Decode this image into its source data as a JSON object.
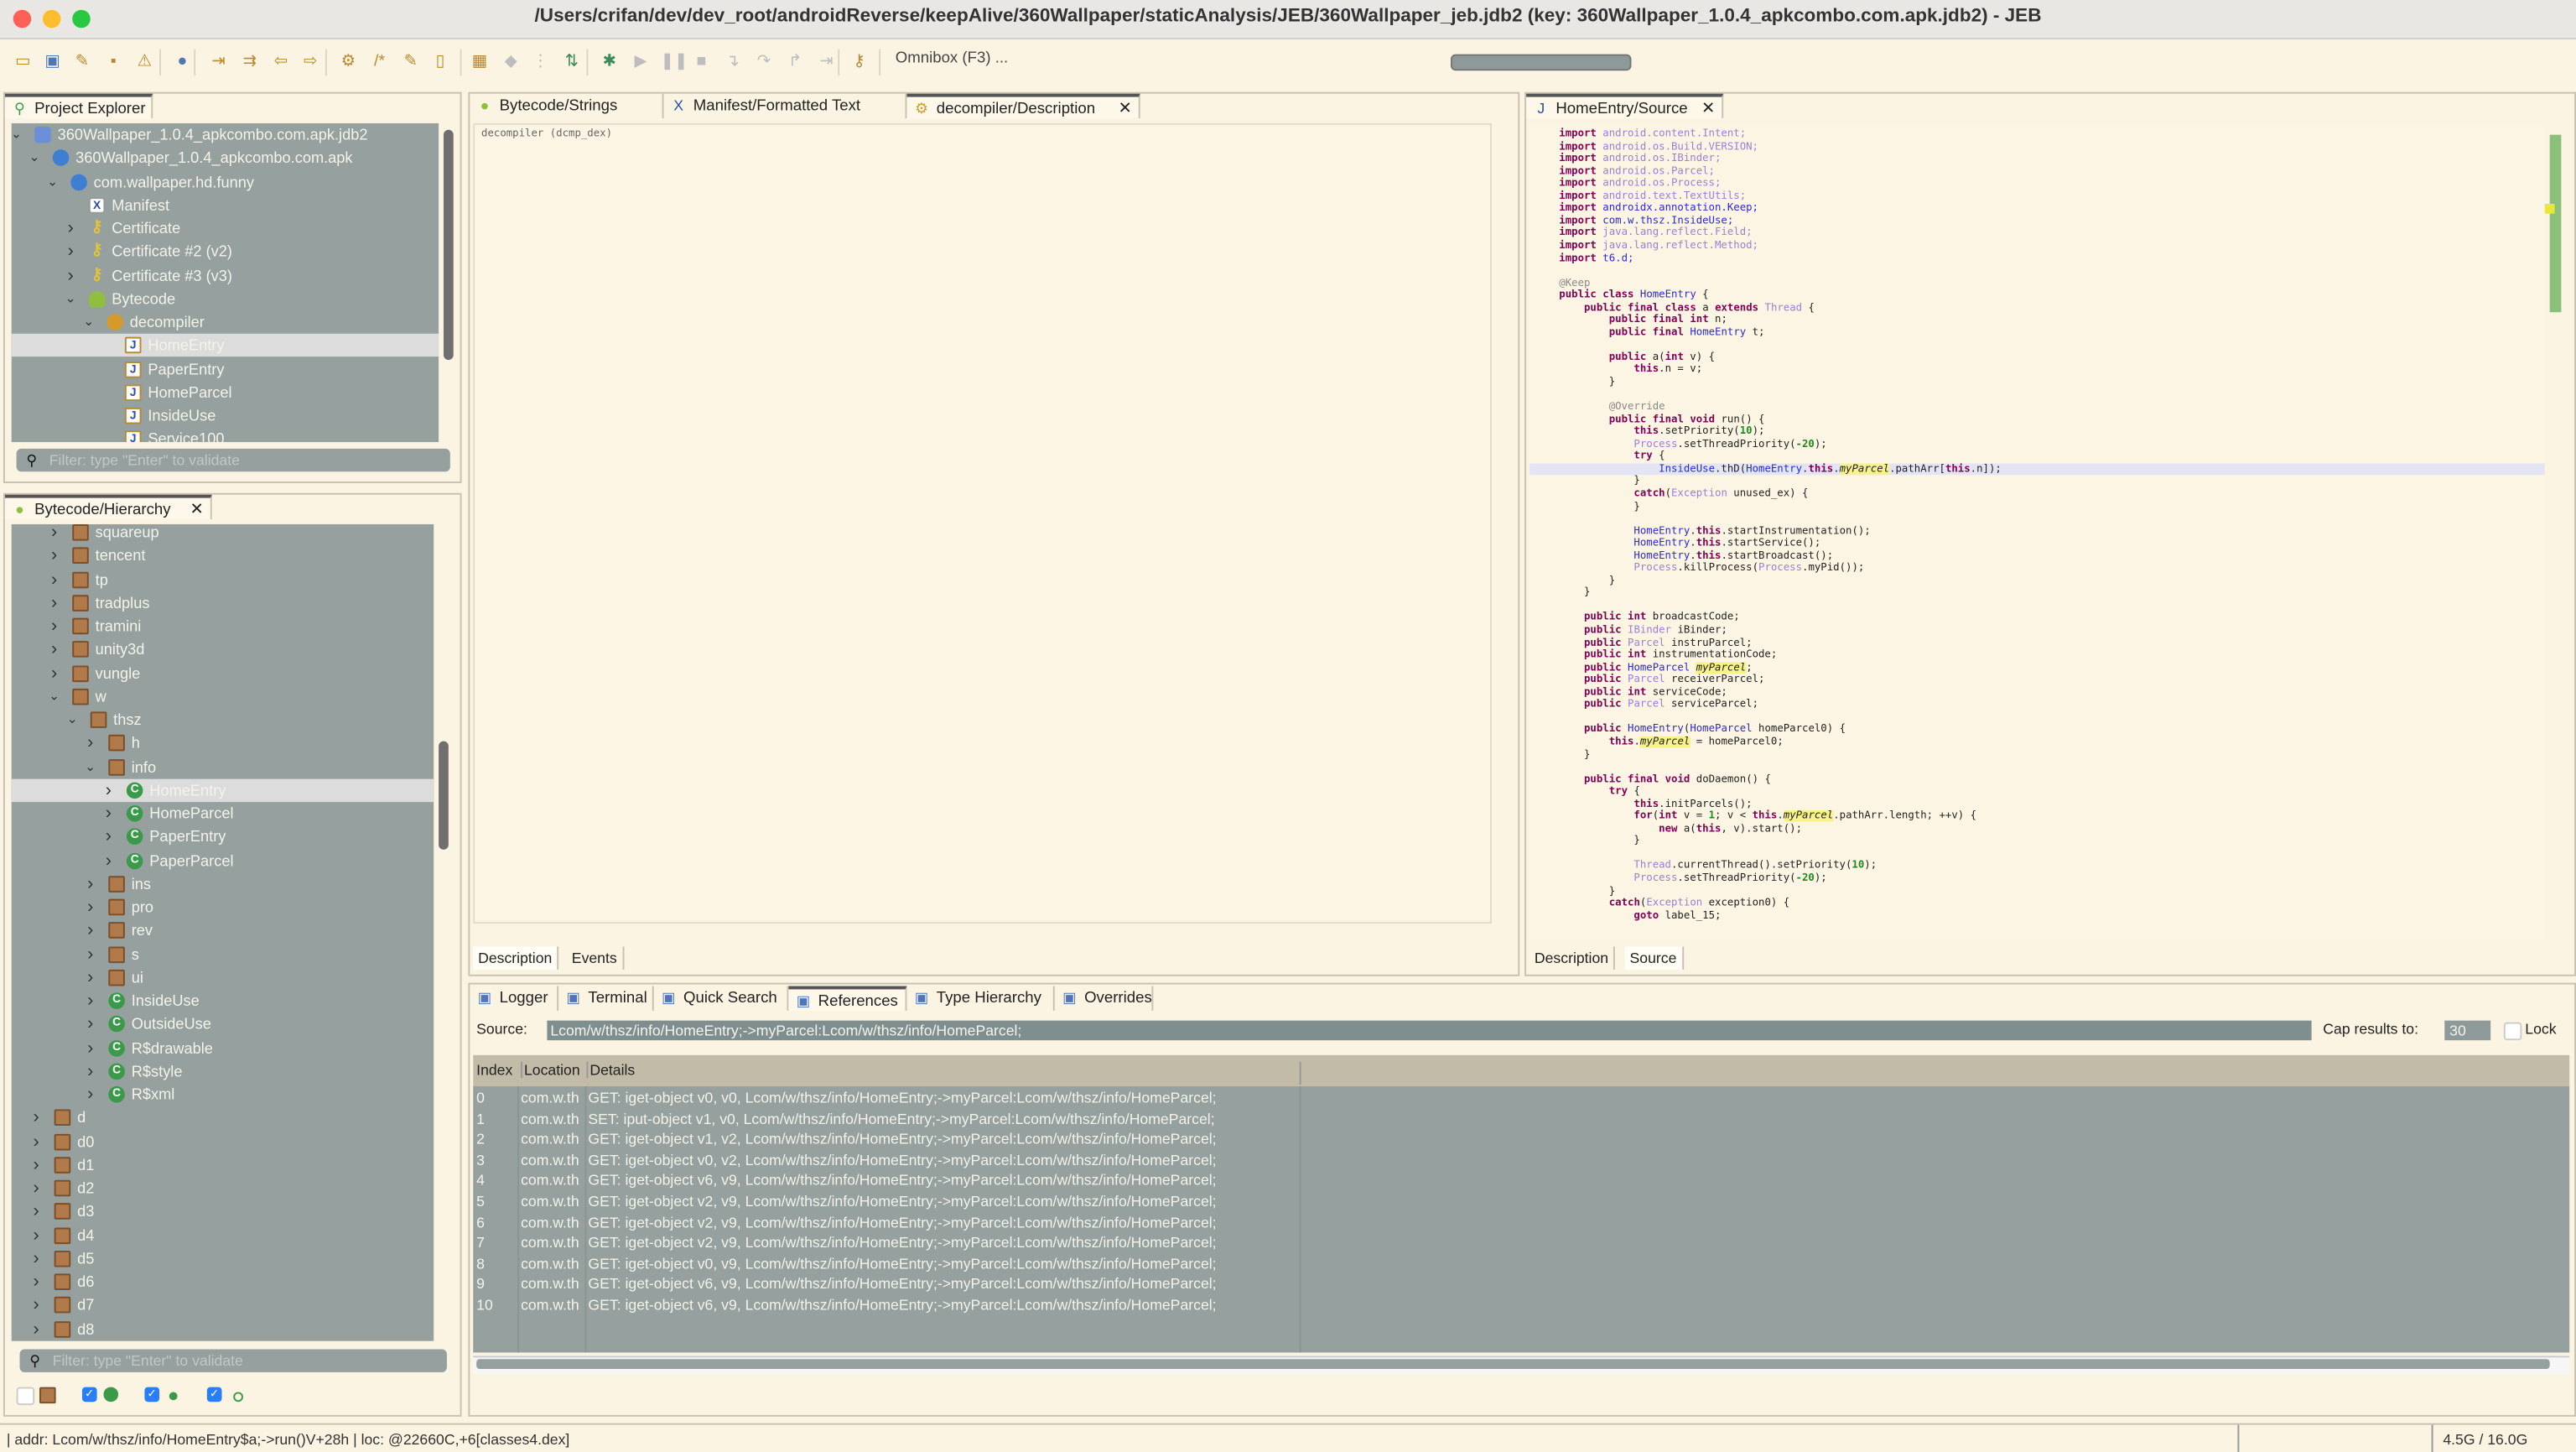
{
  "window": {
    "title": "/Users/crifan/dev/dev_root/androidReverse/keepAlive/360Wallpaper/staticAnalysis/JEB/360Wallpaper_jeb.jdb2 (key: 360Wallpaper_1.0.4_apkcombo.com.apk.jdb2) - JEB"
  },
  "toolbar": {
    "omnibox": "Omnibox (F3) ...",
    "icons": [
      "open-icon",
      "save-icon",
      "wrench-icon",
      "plug-icon",
      "warning-icon",
      "globe-icon",
      "jump-to-icon",
      "navigate-icon",
      "back-arrow-icon",
      "forward-arrow-icon",
      "decompile-icon",
      "comment-icon",
      "rename-icon",
      "export-icon",
      "grid-icon",
      "cube-icon",
      "tree-icon",
      "branch-icon",
      "debug-bug-icon",
      "run-icon",
      "pause-icon",
      "stop-icon",
      "step-into-icon",
      "step-over-icon",
      "step-out-icon",
      "run-to-icon",
      "key-icon"
    ]
  },
  "project_explorer": {
    "tab_label": "Project Explorer",
    "filter_placeholder": "Filter: type \"Enter\" to validate",
    "items": [
      {
        "label": "360Wallpaper_1.0.4_apkcombo.com.apk.jdb2",
        "level": 0,
        "arrow": "down",
        "icon": "folder"
      },
      {
        "label": "360Wallpaper_1.0.4_apkcombo.com.apk",
        "level": 1,
        "arrow": "down",
        "icon": "apk"
      },
      {
        "label": "com.wallpaper.hd.funny",
        "level": 2,
        "arrow": "down",
        "icon": "apk"
      },
      {
        "label": "Manifest",
        "level": 3,
        "arrow": "",
        "icon": "xml"
      },
      {
        "label": "Certificate",
        "level": 3,
        "arrow": "right",
        "icon": "key"
      },
      {
        "label": "Certificate #2 (v2)",
        "level": 3,
        "arrow": "right",
        "icon": "key"
      },
      {
        "label": "Certificate #3 (v3)",
        "level": 3,
        "arrow": "right",
        "icon": "key"
      },
      {
        "label": "Bytecode",
        "level": 3,
        "arrow": "down",
        "icon": "droid"
      },
      {
        "label": "decompiler",
        "level": 4,
        "arrow": "down",
        "icon": "dec"
      },
      {
        "label": "HomeEntry",
        "level": 5,
        "arrow": "",
        "icon": "java",
        "selected": true
      },
      {
        "label": "PaperEntry",
        "level": 5,
        "arrow": "",
        "icon": "java"
      },
      {
        "label": "HomeParcel",
        "level": 5,
        "arrow": "",
        "icon": "java"
      },
      {
        "label": "InsideUse",
        "level": 5,
        "arrow": "",
        "icon": "java"
      },
      {
        "label": "Service100",
        "level": 5,
        "arrow": "",
        "icon": "java"
      }
    ]
  },
  "hierarchy": {
    "tab_label": "Bytecode/Hierarchy",
    "filter_placeholder": "Filter: type \"Enter\" to validate",
    "items": [
      {
        "label": "squareup",
        "level": 1,
        "arrow": "right",
        "icon": "pkg"
      },
      {
        "label": "tencent",
        "level": 1,
        "arrow": "right",
        "icon": "pkg"
      },
      {
        "label": "tp",
        "level": 1,
        "arrow": "right",
        "icon": "pkg"
      },
      {
        "label": "tradplus",
        "level": 1,
        "arrow": "right",
        "icon": "pkg"
      },
      {
        "label": "tramini",
        "level": 1,
        "arrow": "right",
        "icon": "pkg"
      },
      {
        "label": "unity3d",
        "level": 1,
        "arrow": "right",
        "icon": "pkg"
      },
      {
        "label": "vungle",
        "level": 1,
        "arrow": "right",
        "icon": "pkg"
      },
      {
        "label": "w",
        "level": 1,
        "arrow": "down",
        "icon": "pkg"
      },
      {
        "label": "thsz",
        "level": 2,
        "arrow": "down",
        "icon": "pkg"
      },
      {
        "label": "h",
        "level": 3,
        "arrow": "right",
        "icon": "pkg"
      },
      {
        "label": "info",
        "level": 3,
        "arrow": "down",
        "icon": "pkg"
      },
      {
        "label": "HomeEntry",
        "level": 4,
        "arrow": "right",
        "icon": "cls",
        "selected": true
      },
      {
        "label": "HomeParcel",
        "level": 4,
        "arrow": "right",
        "icon": "cls"
      },
      {
        "label": "PaperEntry",
        "level": 4,
        "arrow": "right",
        "icon": "cls"
      },
      {
        "label": "PaperParcel",
        "level": 4,
        "arrow": "right",
        "icon": "cls"
      },
      {
        "label": "ins",
        "level": 3,
        "arrow": "right",
        "icon": "pkg"
      },
      {
        "label": "pro",
        "level": 3,
        "arrow": "right",
        "icon": "pkg"
      },
      {
        "label": "rev",
        "level": 3,
        "arrow": "right",
        "icon": "pkg"
      },
      {
        "label": "s",
        "level": 3,
        "arrow": "right",
        "icon": "pkg"
      },
      {
        "label": "ui",
        "level": 3,
        "arrow": "right",
        "icon": "pkg"
      },
      {
        "label": "InsideUse",
        "level": 3,
        "arrow": "right",
        "icon": "cls"
      },
      {
        "label": "OutsideUse",
        "level": 3,
        "arrow": "right",
        "icon": "cls"
      },
      {
        "label": "R$drawable",
        "level": 3,
        "arrow": "right",
        "icon": "cls"
      },
      {
        "label": "R$style",
        "level": 3,
        "arrow": "right",
        "icon": "cls"
      },
      {
        "label": "R$xml",
        "level": 3,
        "arrow": "right",
        "icon": "cls"
      },
      {
        "label": "d",
        "level": 0,
        "arrow": "right",
        "icon": "pkg"
      },
      {
        "label": "d0",
        "level": 0,
        "arrow": "right",
        "icon": "pkg"
      },
      {
        "label": "d1",
        "level": 0,
        "arrow": "right",
        "icon": "pkg"
      },
      {
        "label": "d2",
        "level": 0,
        "arrow": "right",
        "icon": "pkg"
      },
      {
        "label": "d3",
        "level": 0,
        "arrow": "right",
        "icon": "pkg"
      },
      {
        "label": "d4",
        "level": 0,
        "arrow": "right",
        "icon": "pkg"
      },
      {
        "label": "d5",
        "level": 0,
        "arrow": "right",
        "icon": "pkg"
      },
      {
        "label": "d6",
        "level": 0,
        "arrow": "right",
        "icon": "pkg"
      },
      {
        "label": "d7",
        "level": 0,
        "arrow": "right",
        "icon": "pkg"
      },
      {
        "label": "d8",
        "level": 0,
        "arrow": "right",
        "icon": "pkg"
      }
    ],
    "filters": [
      {
        "checked": false,
        "icon": "package-icon"
      },
      {
        "checked": true,
        "icon": "class-icon"
      },
      {
        "checked": true,
        "icon": "method-icon"
      },
      {
        "checked": true,
        "icon": "field-icon"
      }
    ]
  },
  "center_editor": {
    "tabs": [
      {
        "label": "Bytecode/Strings",
        "icon": "android-icon"
      },
      {
        "label": "Manifest/Formatted Text",
        "icon": "xml-icon"
      },
      {
        "label": "decompiler/Description",
        "icon": "decompiler-icon",
        "active": true,
        "closable": true
      }
    ],
    "content": "decompiler (dcmp_dex)",
    "bottom_tabs": [
      {
        "label": "Description",
        "active": true
      },
      {
        "label": "Events"
      }
    ]
  },
  "source_editor": {
    "tab_label": "HomeEntry/Source",
    "bottom_tabs": [
      {
        "label": "Description"
      },
      {
        "label": "Source",
        "active": true
      }
    ],
    "highlight_word": "myParcel",
    "current_line": 28,
    "code": [
      "import android.content.Intent;",
      "import android.os.Build.VERSION;",
      "import android.os.IBinder;",
      "import android.os.Parcel;",
      "import android.os.Process;",
      "import android.text.TextUtils;",
      "import androidx.annotation.Keep;",
      "import com.w.thsz.InsideUse;",
      "import java.lang.reflect.Field;",
      "import java.lang.reflect.Method;",
      "import t6.d;",
      "",
      "@Keep",
      "public class HomeEntry {",
      "    public final class a extends Thread {",
      "        public final int n;",
      "        public final HomeEntry t;",
      "",
      "        public a(int v) {",
      "            this.n = v;",
      "        }",
      "",
      "        @Override",
      "        public final void run() {",
      "            this.setPriority(10);",
      "            Process.setThreadPriority(-20);",
      "            try {",
      "                InsideUse.thD(HomeEntry.this.myParcel.pathArr[this.n]);",
      "            }",
      "            catch(Exception unused_ex) {",
      "            }",
      "",
      "            HomeEntry.this.startInstrumentation();",
      "            HomeEntry.this.startService();",
      "            HomeEntry.this.startBroadcast();",
      "            Process.killProcess(Process.myPid());",
      "        }",
      "    }",
      "",
      "    public int broadcastCode;",
      "    public IBinder iBinder;",
      "    public Parcel instruParcel;",
      "    public int instrumentationCode;",
      "    public HomeParcel myParcel;",
      "    public Parcel receiverParcel;",
      "    public int serviceCode;",
      "    public Parcel serviceParcel;",
      "",
      "    public HomeEntry(HomeParcel homeParcel0) {",
      "        this.myParcel = homeParcel0;",
      "    }",
      "",
      "    public final void doDaemon() {",
      "        try {",
      "            this.initParcels();",
      "            for(int v = 1; v < this.myParcel.pathArr.length; ++v) {",
      "                new a(this, v).start();",
      "            }",
      "",
      "            Thread.currentThread().setPriority(10);",
      "            Process.setThreadPriority(-20);",
      "        }",
      "        catch(Exception exception0) {",
      "            goto label_15;"
    ]
  },
  "bottom_panel": {
    "tabs": [
      {
        "label": "Logger",
        "icon": "logger-icon"
      },
      {
        "label": "Terminal",
        "icon": "terminal-icon"
      },
      {
        "label": "Quick Search",
        "icon": "quick-search-icon"
      },
      {
        "label": "References",
        "icon": "references-icon",
        "active": true
      },
      {
        "label": "Type Hierarchy",
        "icon": "type-hierarchy-icon"
      },
      {
        "label": "Overrides",
        "icon": "overrides-icon"
      }
    ],
    "source_label": "Source:",
    "source_value": "Lcom/w/thsz/info/HomeEntry;->myParcel:Lcom/w/thsz/info/HomeParcel;",
    "cap_label": "Cap results to:",
    "cap_value": "30",
    "lock_label": "Lock",
    "lock_checked": false,
    "columns": [
      "Index",
      "Location",
      "Details"
    ],
    "rows": [
      [
        "0",
        "com.w.th",
        "GET: iget-object v0, v0, Lcom/w/thsz/info/HomeEntry;->myParcel:Lcom/w/thsz/info/HomeParcel;"
      ],
      [
        "1",
        "com.w.th",
        "SET: iput-object v1, v0, Lcom/w/thsz/info/HomeEntry;->myParcel:Lcom/w/thsz/info/HomeParcel;"
      ],
      [
        "2",
        "com.w.th",
        "GET: iget-object v1, v2, Lcom/w/thsz/info/HomeEntry;->myParcel:Lcom/w/thsz/info/HomeParcel;"
      ],
      [
        "3",
        "com.w.th",
        "GET: iget-object v0, v2, Lcom/w/thsz/info/HomeEntry;->myParcel:Lcom/w/thsz/info/HomeParcel;"
      ],
      [
        "4",
        "com.w.th",
        "GET: iget-object v6, v9, Lcom/w/thsz/info/HomeEntry;->myParcel:Lcom/w/thsz/info/HomeParcel;"
      ],
      [
        "5",
        "com.w.th",
        "GET: iget-object v2, v9, Lcom/w/thsz/info/HomeEntry;->myParcel:Lcom/w/thsz/info/HomeParcel;"
      ],
      [
        "6",
        "com.w.th",
        "GET: iget-object v2, v9, Lcom/w/thsz/info/HomeEntry;->myParcel:Lcom/w/thsz/info/HomeParcel;"
      ],
      [
        "7",
        "com.w.th",
        "GET: iget-object v2, v9, Lcom/w/thsz/info/HomeEntry;->myParcel:Lcom/w/thsz/info/HomeParcel;"
      ],
      [
        "8",
        "com.w.th",
        "GET: iget-object v0, v9, Lcom/w/thsz/info/HomeEntry;->myParcel:Lcom/w/thsz/info/HomeParcel;"
      ],
      [
        "9",
        "com.w.th",
        "GET: iget-object v6, v9, Lcom/w/thsz/info/HomeEntry;->myParcel:Lcom/w/thsz/info/HomeParcel;"
      ],
      [
        "10",
        "com.w.th",
        "GET: iget-object v6, v9, Lcom/w/thsz/info/HomeEntry;->myParcel:Lcom/w/thsz/info/HomeParcel;"
      ]
    ]
  },
  "status_bar": {
    "address": "| addr: Lcom/w/thsz/info/HomeEntry$a;->run()V+28h | loc: @22660C,+6[classes4.dex]",
    "memory": "4.5G / 16.0G"
  },
  "colors": {
    "tree_bg": "#95a09f",
    "panel_bg": "#fbf4e2",
    "keyword": "#7f0055",
    "highlight": "#f7f28a"
  }
}
